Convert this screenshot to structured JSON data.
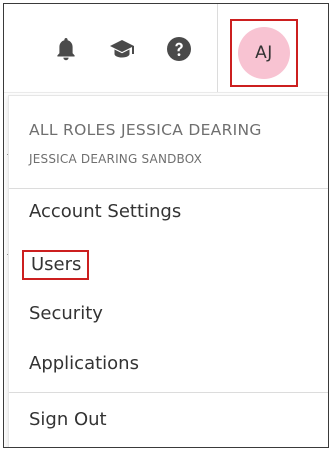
{
  "topbar": {
    "icons": [
      {
        "name": "bell-icon",
        "label": "Notifications"
      },
      {
        "name": "graduation-cap-icon",
        "label": "Learning"
      },
      {
        "name": "help-icon",
        "label": "Help"
      }
    ],
    "avatar": {
      "initials": "AJ",
      "background": "#f8c3d2"
    }
  },
  "menu": {
    "role": "ALL ROLES JESSICA DEARING",
    "account": "JESSICA DEARING SANDBOX",
    "items": [
      {
        "label": "Account Settings"
      },
      {
        "label": "Users"
      },
      {
        "label": "Security"
      },
      {
        "label": "Applications"
      }
    ],
    "sign_out": "Sign Out"
  },
  "highlight_color": "#cc1f1f"
}
